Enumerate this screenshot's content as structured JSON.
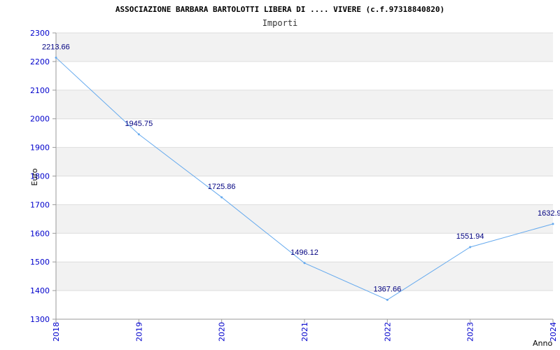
{
  "chart_data": {
    "type": "line",
    "title": "ASSOCIAZIONE BARBARA BARTOLOTTI LIBERA DI .... VIVERE (c.f.97318840820)",
    "subtitle": "Importi",
    "xlabel": "Anno",
    "ylabel": "Euro",
    "x": [
      "2018",
      "2019",
      "2020",
      "2021",
      "2022",
      "2023",
      "2024"
    ],
    "series": [
      {
        "values": [
          2213.66,
          1945.75,
          1725.86,
          1496.12,
          1367.66,
          1551.94,
          1632.9
        ],
        "labels": [
          "2213.66",
          "1945.75",
          "1725.86",
          "1496.12",
          "1367.66",
          "1551.94",
          "1632.9"
        ]
      }
    ],
    "ylim": [
      1300,
      2300
    ],
    "yticks": [
      "1300",
      "1400",
      "1500",
      "1600",
      "1700",
      "1800",
      "1900",
      "2000",
      "2100",
      "2200",
      "2300"
    ],
    "grid": true,
    "colors": {
      "line": "#66aaee",
      "band": "#f2f2f2",
      "tick_text": "#0000cc",
      "label_text": "#000080"
    }
  }
}
